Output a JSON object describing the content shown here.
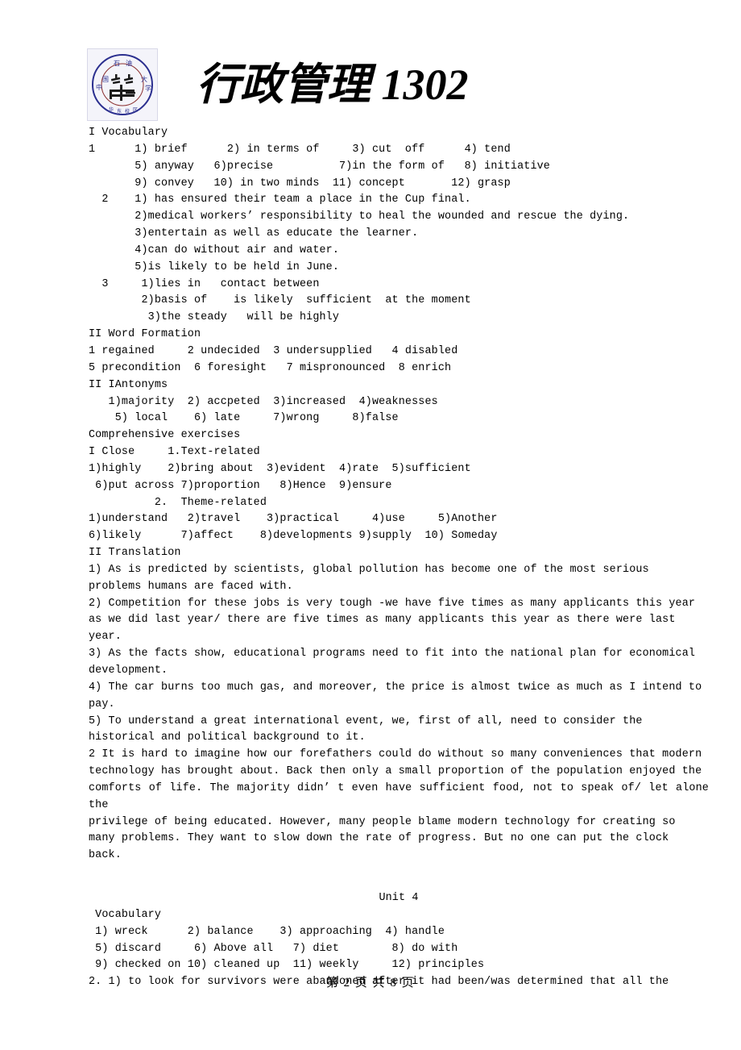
{
  "header": {
    "title": "行政管理 1302",
    "logo_name": "china-university-of-petroleum-seal",
    "logo_text_top": "石 油",
    "logo_text_left": "中 国",
    "logo_text_right": "大 学",
    "logo_text_bottom": "华 东 校 区"
  },
  "sections": {
    "vocabulary_heading": "I Vocabulary",
    "v1_line1": "1      1) brief      2) in terms of     3) cut  off      4) tend",
    "v1_line2": "       5) anyway   6)precise          7)in the form of   8) initiative",
    "v1_line3": "       9) convey   10) in two minds  11) concept       12) grasp",
    "v2_line1": "  2    1) has ensured their team a place in the Cup final.",
    "v2_line2": "       2)medical workers’ responsibility to heal the wounded and rescue the dying.",
    "v2_line3": "       3)entertain as well as educate the learner.",
    "v2_line4": "       4)can do without air and water.",
    "v2_line5": "       5)is likely to be held in June.",
    "v3_line1": "  3     1)lies in   contact between",
    "v3_line2": "        2)basis of    is likely  sufficient  at the moment",
    "v3_line3": "         3)the steady   will be highly",
    "word_formation_heading": "II Word Formation",
    "wf_line1": "1 regained     2 undecided  3 undersupplied   4 disabled",
    "wf_line2": "5 precondition  6 foresight   7 mispronounced  8 enrich",
    "antonyms_heading": "II IAntonyms",
    "ant_line1": "   1)majority  2) accpeted  3)increased  4)weaknesses",
    "ant_line2": "    5) local    6) late     7)wrong     8)false",
    "comprehensive_heading": "Comprehensive exercises",
    "close_heading": "I Close     1.Text-related",
    "close_line1": "1)highly    2)bring about  3)evident  4)rate  5)sufficient",
    "close_line2": " 6)put across 7)proportion   8)Hence  9)ensure",
    "theme_heading": "          2.  Theme-related",
    "theme_line1": "1)understand   2)travel    3)practical     4)use     5)Another",
    "theme_line2": "6)likely      7)affect    8)developments 9)supply  10) Someday",
    "translation_heading": "II Translation",
    "t1_a": "1) As is predicted by scientists, global pollution has become one of the most serious",
    "t1_b": "problems humans are faced with.",
    "t2_a": "2) Competition for these jobs is very tough -we have five times as many applicants this year",
    "t2_b": "as we did last year/ there are five times as many applicants this year as there were last",
    "t2_c": "year.",
    "t3_a": "3) As the facts show, educational programs need to fit into the national plan for economical",
    "t3_b": "development.",
    "t4_a": "4) The car burns too much gas, and moreover, the price is almost twice as much as I intend to",
    "t4_b": "pay.",
    "t5_a": "5) To understand a great international event, we, first of all, need to consider the",
    "t5_b": "historical and political background to it.",
    "p2_a": "2 It is hard to imagine how our forefathers could do without so many conveniences that modern",
    "p2_b": "technology has brought about. Back then only a small proportion of the population enjoyed the",
    "p2_c": "comforts of life. The majority didn’ t even have sufficient food, not to speak of/ let alone the",
    "p2_d": "privilege of being educated. However, many people blame modern technology for creating so",
    "p2_e": "many problems. They want to slow down the rate of progress. But no one can put the clock",
    "p2_f": "back.",
    "unit4_heading": "Unit 4",
    "u4_vocab_heading": " Vocabulary",
    "u4_line1": " 1) wreck      2) balance    3) approaching  4) handle",
    "u4_line2": " 5) discard     6) Above all   7) diet        8) do with",
    "u4_line3": " 9) checked on 10) cleaned up  11) weekly     12) principles",
    "u4_line4": "2. 1) to look for survivors were abandoned after it had been/was determined that all the"
  },
  "footer": {
    "page_text": "第 2 页 共 8 页"
  }
}
